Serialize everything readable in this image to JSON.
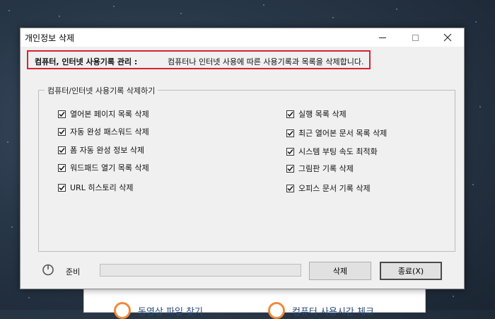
{
  "background_window": {
    "items": [
      {
        "label": "동영상 파일 찾기",
        "icon": "clock-icon"
      },
      {
        "label": "컴퓨터 사용시간 체크",
        "icon": "clock-icon"
      }
    ]
  },
  "dialog": {
    "title": "개인정보 삭제",
    "window_controls": {
      "minimize": "minimize-icon",
      "maximize": "maximize-icon",
      "close": "close-icon"
    },
    "banner": {
      "title": "컴퓨터, 인터넷 사용기록 관리 :",
      "description": "컴퓨터나 인터넷 사용에 따른 사용기록과 목록을 삭제합니다.",
      "border_color": "#d9232e"
    },
    "group": {
      "legend": "컴퓨터/인터넷 사용기록 삭제하기",
      "left_options": [
        {
          "label": "열어본 페이지 목록 삭제",
          "checked": true
        },
        {
          "label": "자동 완성 패스워드 삭제",
          "checked": true
        },
        {
          "label": "폼 자동 완성 정보 삭제",
          "checked": true
        },
        {
          "label": "워드패드 열기 목록 삭제",
          "checked": true
        },
        {
          "label": "URL 히스토리 삭제",
          "checked": true
        }
      ],
      "right_options": [
        {
          "label": "실행 목록 삭제",
          "checked": true
        },
        {
          "label": "최근 열어본 문서 목록 삭제",
          "checked": true
        },
        {
          "label": "시스템 부팅 속도 최적화",
          "checked": true
        },
        {
          "label": "그림판 기록 삭제",
          "checked": true
        },
        {
          "label": "오피스 문서 기록 삭제",
          "checked": true
        }
      ]
    },
    "status": {
      "icon": "power-icon",
      "label": "준비",
      "progress": 0
    },
    "buttons": {
      "delete": "삭제",
      "exit": "종료(X)"
    }
  }
}
